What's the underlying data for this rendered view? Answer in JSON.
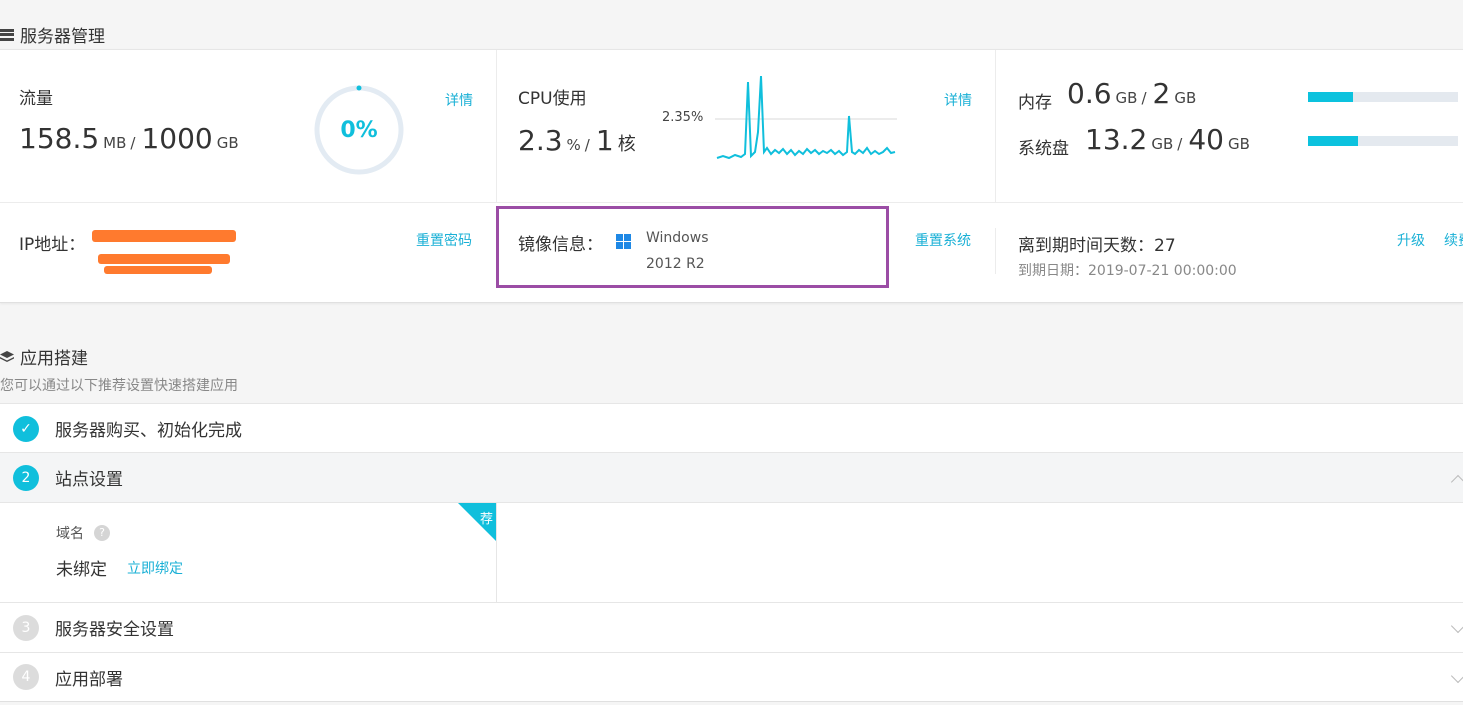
{
  "server_section": {
    "title": "服务器管理",
    "traffic": {
      "label": "流量",
      "used": "158.5",
      "used_unit": "MB",
      "sep": "/",
      "total": "1000",
      "total_unit": "GB",
      "percent_label": "0%",
      "percent": 0,
      "detail_link": "详情"
    },
    "cpu": {
      "label": "CPU使用",
      "value": "2.3",
      "unit": "%",
      "sep": "/",
      "cores": "1",
      "cores_unit": "核",
      "chart_label": "2.35%",
      "detail_link": "详情"
    },
    "memory": {
      "label": "内存",
      "used": "0.6",
      "used_unit": "GB",
      "sep": "/",
      "total": "2",
      "total_unit": "GB",
      "fill_fraction": 0.3
    },
    "disk": {
      "label": "系统盘",
      "used": "13.2",
      "used_unit": "GB",
      "sep": "/",
      "total": "40",
      "total_unit": "GB",
      "fill_fraction": 0.33
    },
    "ip": {
      "label": "IP地址：",
      "reset_password": "重置密码"
    },
    "image": {
      "label": "镜像信息：",
      "os_line1": "Windows",
      "os_line2": "2012 R2",
      "reset_system": "重置系统"
    },
    "expiry": {
      "days_label": "离到期时间天数：",
      "days": "27",
      "date_label": "到期日期：",
      "date": "2019-07-21 00:00:00",
      "upgrade": "升级",
      "renew": "续费"
    }
  },
  "app_section": {
    "title": "应用搭建",
    "hint": "您可以通过以下推荐设置快速搭建应用",
    "steps": [
      {
        "num": "✓",
        "label": "服务器购买、初始化完成"
      },
      {
        "num": "2",
        "label": "站点设置"
      },
      {
        "num": "3",
        "label": "服务器安全设置"
      },
      {
        "num": "4",
        "label": "应用部署"
      }
    ],
    "domain": {
      "label": "域名",
      "help": "?",
      "status": "未绑定",
      "bind_link": "立即绑定",
      "badge": "荐"
    }
  },
  "colors": {
    "accent": "#10bfdc",
    "highlight_border": "#9b4da5",
    "redaction": "#ff7a2e"
  }
}
